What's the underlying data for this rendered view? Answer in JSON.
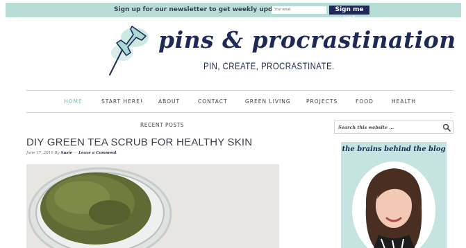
{
  "newsletter": {
    "message": "Sign up for our newsletter to get weekly updates!",
    "email_placeholder": "Your email",
    "button_label": "Sign me up!"
  },
  "header": {
    "site_title": "pins & procrastination",
    "tagline": "PIN, CREATE, PROCRASTINATE."
  },
  "nav": {
    "items": [
      {
        "label": "HOME",
        "active": true
      },
      {
        "label": "START HERE!",
        "active": false
      },
      {
        "label": "ABOUT",
        "active": false
      },
      {
        "label": "CONTACT",
        "active": false
      },
      {
        "label": "GREEN LIVING",
        "active": false
      },
      {
        "label": "PROJECTS",
        "active": false
      },
      {
        "label": "FOOD",
        "active": false
      },
      {
        "label": "HEALTH",
        "active": false
      }
    ]
  },
  "main": {
    "section_label": "RECENT POSTS",
    "post": {
      "title": "DIY GREEN TEA SCRUB FOR HEALTHY SKIN",
      "date": "June 17, 2016",
      "by": "By",
      "author": "Susie",
      "separator": "—",
      "comment_link": "Leave a Comment"
    }
  },
  "sidebar": {
    "search_placeholder": "Search this website ...",
    "about_heading": "the brains behind the blog"
  },
  "colors": {
    "accent": "#b8ddd7",
    "brand_navy": "#1e2a55",
    "active_nav": "#6fbcb5",
    "text": "#3a3f4a"
  },
  "icons": {
    "logo": "pushpin-icon",
    "search": "magnifier-icon"
  }
}
